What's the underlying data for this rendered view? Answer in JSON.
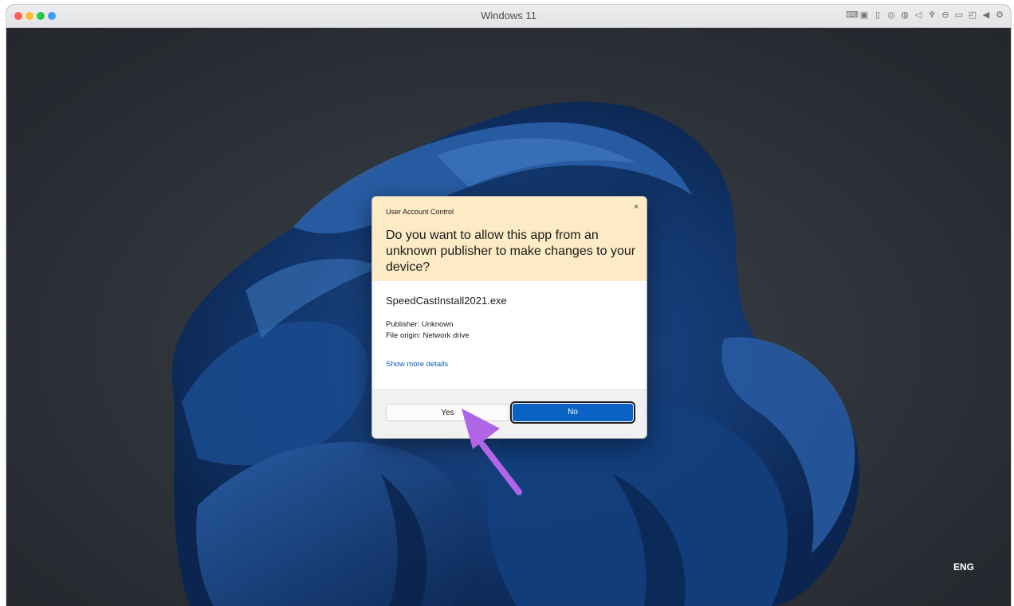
{
  "window": {
    "title": "Windows 11",
    "traffic_lights": [
      "close",
      "minimize",
      "zoom",
      "extra"
    ],
    "toolbar_icons": [
      "keyboard-icon",
      "cpu-icon",
      "usb-icon",
      "disc-icon",
      "globe-icon",
      "speaker-icon",
      "microphone-icon",
      "printer-icon",
      "camera-icon",
      "screen-share-icon",
      "arrow-left-icon",
      "gear-icon"
    ]
  },
  "desktop": {
    "language_indicator": "ENG"
  },
  "uac_dialog": {
    "caption": "User Account Control",
    "question": "Do you want to allow this app from an unknown publisher to make changes to your device?",
    "app_name": "SpeedCastInstall2021.exe",
    "publisher": "Publisher: Unknown",
    "file_origin": "File origin: Network drive",
    "details_link": "Show more details",
    "yes_label": "Yes",
    "no_label": "No",
    "close_glyph": "×"
  },
  "annotation": {
    "arrow_color": "#b064e6"
  },
  "colors": {
    "dialog_header": "#fcebc5",
    "primary_button": "#0a63c4",
    "link": "#0b5cad"
  }
}
